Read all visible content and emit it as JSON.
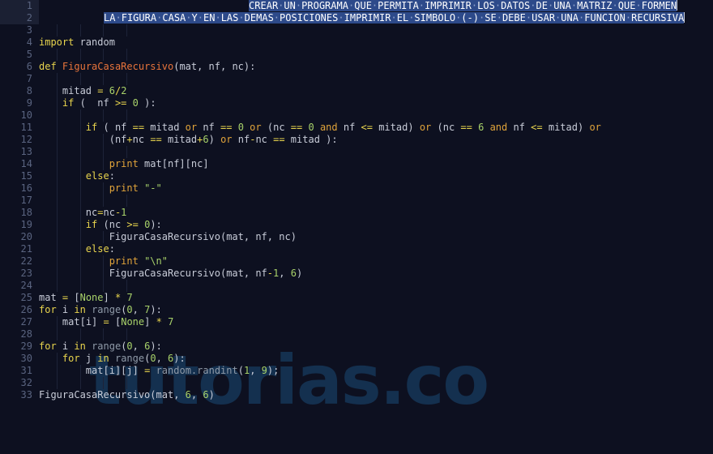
{
  "editor": {
    "language": "python",
    "background_color": "#0d1020",
    "gutter_selected_color": "#1b2033",
    "selection_color": "#2d4a8a",
    "line_number_color": "#5a6480",
    "indent_guide_color": "#1d2338",
    "total_lines": 33
  },
  "watermark": {
    "text": "tutorias.co",
    "color": "#14304f"
  },
  "colors": {
    "keyword": "#e8d44d",
    "operator": "#e8d44d",
    "logic_operator": "#e0a33a",
    "function_def": "#e8743b",
    "builtin_call": "#8f9aa8",
    "number": "#a8d26a",
    "string": "#a8d26a",
    "constant": "#a8d26a",
    "plain": "#c8ccd8"
  },
  "selection": {
    "line1_text": "CREAR UN PROGRAMA QUE PERMITA IMPRIMIR LOS DATOS DE UNA MATRIZ QUE FORMEN",
    "line2_text": "LA FIGURA CASA Y EN LAS DEMAS POSICIONES IMPRIMIR EL SIMBOLO (-) SE DEBE USAR UNA FUNCION RECURSIVA",
    "selected_lines": [
      1,
      2
    ],
    "whitespace_marker": "·"
  },
  "line_numbers": [
    1,
    2,
    3,
    4,
    5,
    6,
    7,
    8,
    9,
    10,
    11,
    12,
    13,
    14,
    15,
    16,
    17,
    18,
    19,
    20,
    21,
    22,
    23,
    24,
    25,
    26,
    27,
    28,
    29,
    30,
    31,
    32,
    33
  ],
  "code_lines": {
    "l1": "CREAR UN PROGRAMA QUE PERMITA IMPRIMIR LOS DATOS DE UNA MATRIZ QUE FORMEN",
    "l2": "LA FIGURA CASA Y EN LAS DEMAS POSICIONES IMPRIMIR EL SIMBOLO (-) SE DEBE USAR UNA FUNCION RECURSIVA",
    "l3": "",
    "l4": "import random",
    "l5": "",
    "l6": "def FiguraCasaRecursivo(mat, nf, nc):",
    "l7": "",
    "l8": "    mitad = 6/2",
    "l9": "    if (  nf >= 0 ):",
    "l10": "",
    "l11": "        if ( nf == mitad or nf == 0 or (nc == 0 and nf <= mitad) or (nc == 6 and nf <= mitad) or",
    "l12": "            (nf+nc == mitad+6) or nf-nc == mitad ):",
    "l13": "",
    "l14": "            print mat[nf][nc]",
    "l15": "        else:",
    "l16": "            print \"-\"",
    "l17": "",
    "l18": "        nc=nc-1",
    "l19": "        if (nc >= 0):",
    "l20": "            FiguraCasaRecursivo(mat, nf, nc)",
    "l21": "        else:",
    "l22": "            print \"\\n\"",
    "l23": "            FiguraCasaRecursivo(mat, nf-1, 6)",
    "l24": "",
    "l25": "mat = [None] * 7",
    "l26": "for i in range(0, 7):",
    "l27": "    mat[i] = [None] * 7",
    "l28": "",
    "l29": "for i in range(0, 6):",
    "l30": "    for j in range(0, 6):",
    "l31": "        mat[i][j] = random.randint(1, 9);",
    "l32": "",
    "l33": "FiguraCasaRecursivo(mat, 6, 6)"
  }
}
